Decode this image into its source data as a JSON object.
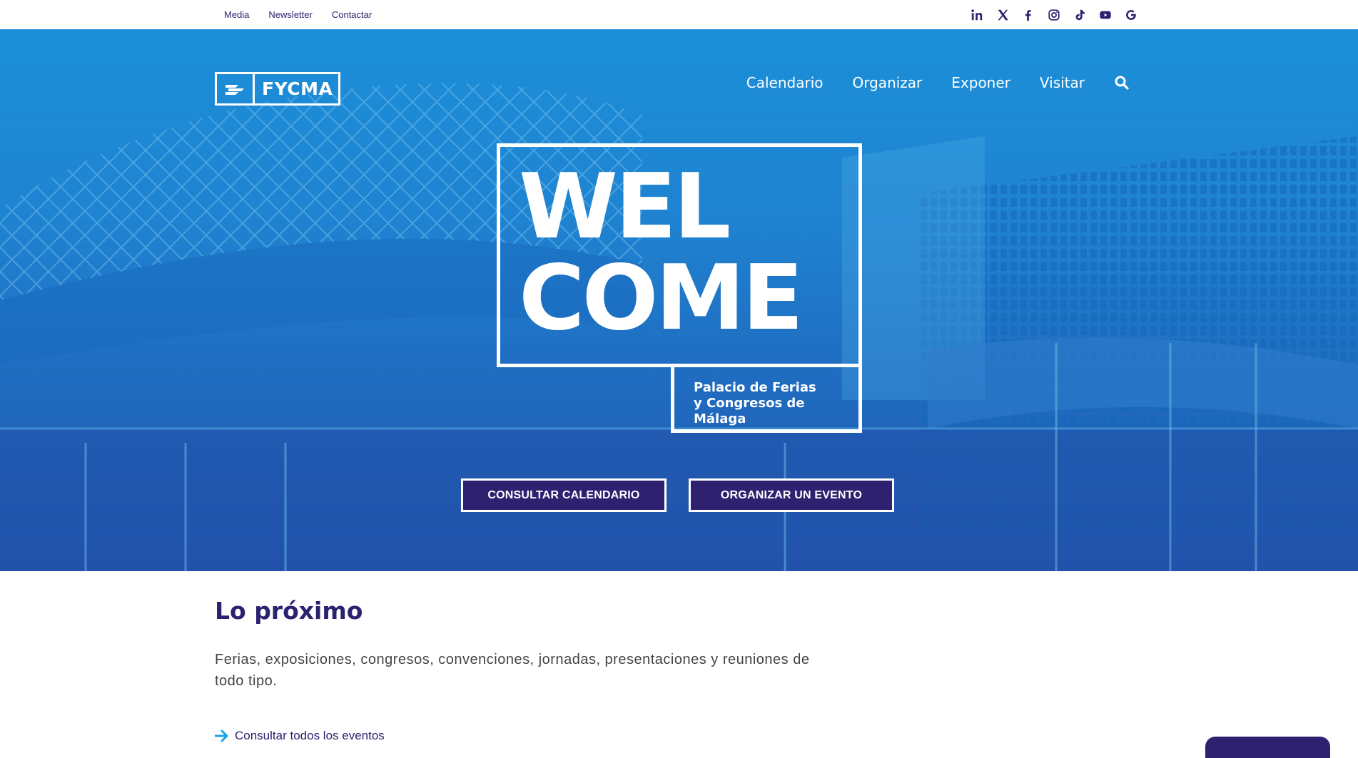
{
  "topbar": {
    "links": [
      "Media",
      "Newsletter",
      "Contactar"
    ],
    "social_icons": [
      "linkedin-icon",
      "x-icon",
      "facebook-icon",
      "instagram-icon",
      "tiktok-icon",
      "youtube-icon",
      "google-icon"
    ]
  },
  "header": {
    "logo_text": "FYCMA",
    "nav": [
      "Calendario",
      "Organizar",
      "Exponer",
      "Visitar"
    ],
    "search_icon": "search-icon"
  },
  "hero": {
    "welcome": "WEL\nCOME",
    "subtitle_line1": "Palacio de Ferias",
    "subtitle_line2": "y Congresos de Málaga",
    "button_calendar": "CONSULTAR CALENDARIO",
    "button_organize": "ORGANIZAR UN EVENTO"
  },
  "content": {
    "title": "Lo próximo",
    "description": "Ferias, exposiciones, congresos, convenciones, jornadas, presentaciones y reuniones de todo tipo.",
    "link": "Consultar todos los eventos",
    "link_icon": "arrow-right-icon"
  },
  "colors": {
    "brand": "#2e2270",
    "hero_blue": "#1c8fd8",
    "accent_cyan": "#19a6e2"
  }
}
